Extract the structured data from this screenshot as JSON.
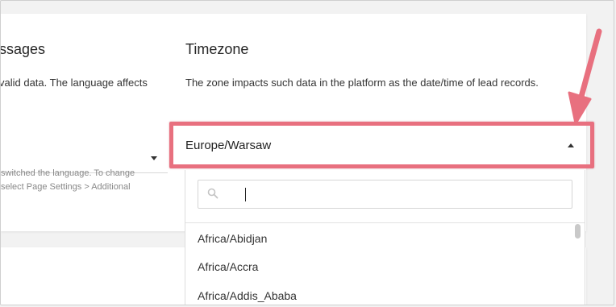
{
  "language": {
    "title_partial": "ssages",
    "description_partial": "valid data. The language affects",
    "hint_line1": "switched the language. To change",
    "hint_line2": "select Page Settings > Additional"
  },
  "timezone": {
    "title": "Timezone",
    "description": "The zone impacts such data in the platform as the date/time of lead records.",
    "selected_value": "Europe/Warsaw",
    "search_placeholder": "",
    "options": [
      "Africa/Abidjan",
      "Africa/Accra",
      "Africa/Addis_Ababa"
    ]
  },
  "icons": {
    "search": "search-icon",
    "caret_down": "caret-down-icon",
    "caret_up": "caret-up-icon",
    "annotation": "arrow-icon"
  },
  "colors": {
    "highlight": "#e8707f",
    "arrow": "#e8707f"
  }
}
